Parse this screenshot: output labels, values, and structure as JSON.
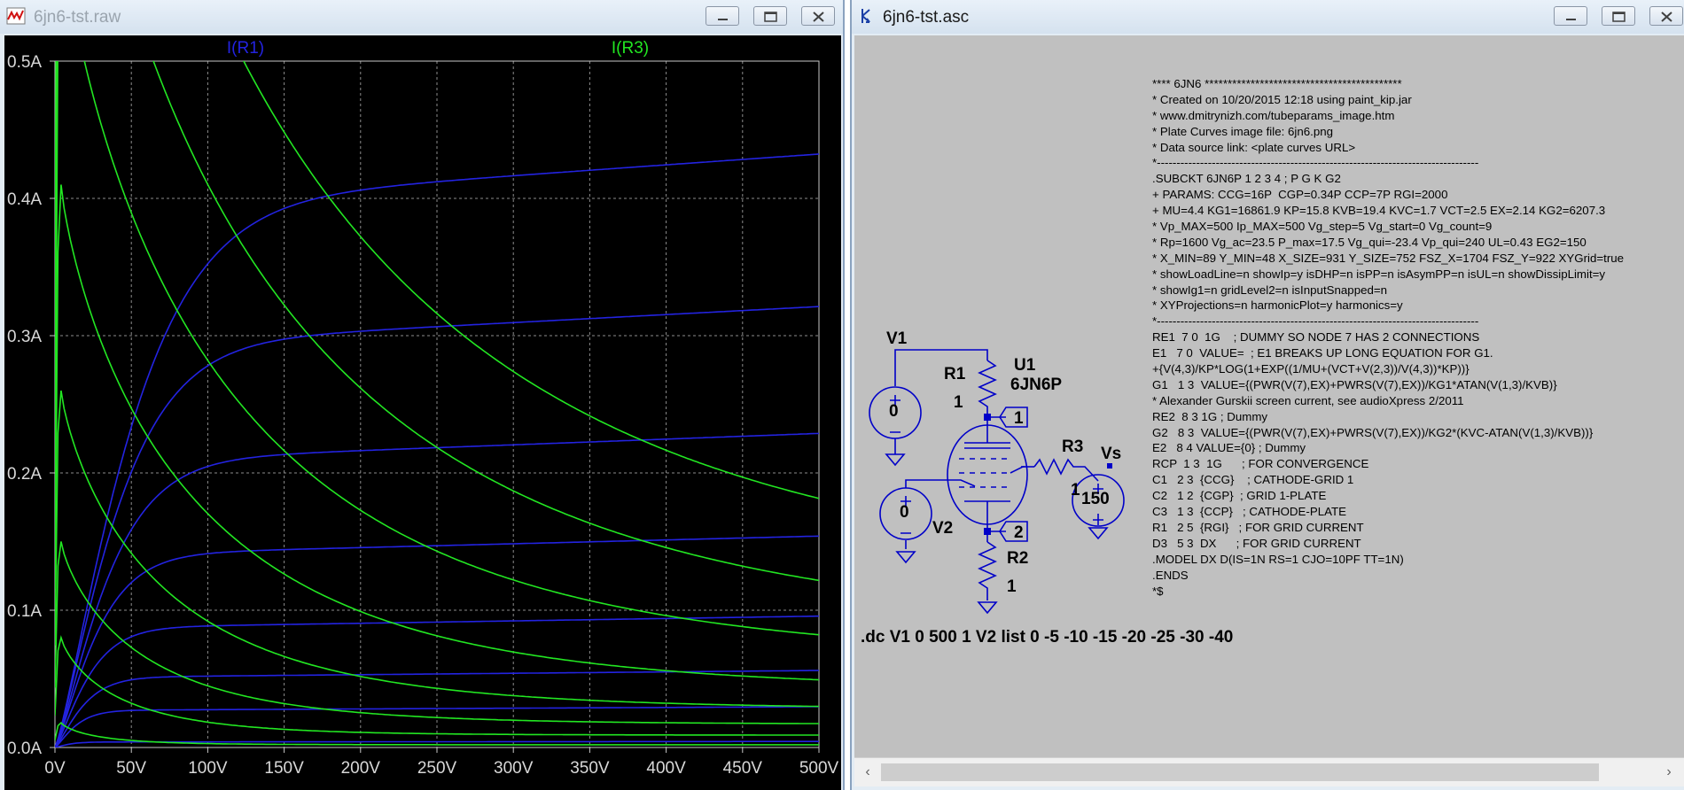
{
  "waveform_window": {
    "title": "6jn6-tst.raw",
    "icon": "waveform-viewer-icon"
  },
  "schematic_window": {
    "title": "6jn6-tst.asc",
    "icon": "schematic-editor-icon"
  },
  "window_controls": {
    "minimize": "minimize-icon",
    "maximize": "maximize-icon",
    "close": "close-icon"
  },
  "colors": {
    "ir1_trace": "#2323e0",
    "ir3_trace": "#22e622",
    "plot_bg": "#000000",
    "schematic_bg": "#c0c0c0",
    "wire": "#0000c8"
  },
  "chart_data": {
    "type": "line",
    "xlabel": "",
    "ylabel": "",
    "xlim": [
      0,
      500
    ],
    "ylim": [
      0,
      0.5
    ],
    "grid": true,
    "legend_placement": "top",
    "x_ticks": [
      "0V",
      "50V",
      "100V",
      "150V",
      "200V",
      "250V",
      "300V",
      "350V",
      "400V",
      "450V",
      "500V"
    ],
    "y_ticks": [
      "0.0A",
      "0.1A",
      "0.2A",
      "0.3A",
      "0.4A",
      "0.5A"
    ],
    "series_groups": [
      {
        "name": "I(R1)",
        "color": "#2323e0",
        "curves": [
          {
            "step": "V2=0",
            "plateau_A": 0.393,
            "knee_V": 55
          },
          {
            "step": "V2=-5",
            "plateau_A": 0.292,
            "knee_V": 45
          },
          {
            "step": "V2=-10",
            "plateau_A": 0.208,
            "knee_V": 38
          },
          {
            "step": "V2=-15",
            "plateau_A": 0.14,
            "knee_V": 30
          },
          {
            "step": "V2=-20",
            "plateau_A": 0.087,
            "knee_V": 24
          },
          {
            "step": "V2=-25",
            "plateau_A": 0.051,
            "knee_V": 20
          },
          {
            "step": "V2=-30",
            "plateau_A": 0.027,
            "knee_V": 15
          },
          {
            "step": "V2=-40",
            "plateau_A": 0.004,
            "knee_V": 10
          }
        ]
      },
      {
        "name": "I(R3)",
        "color": "#22e622",
        "curves": [
          {
            "step": "V2=0",
            "peak_A": 1.0,
            "end_A": 0.116,
            "decay_V": 150
          },
          {
            "step": "V2=-5",
            "peak_A": 0.8,
            "end_A": 0.083,
            "decay_V": 130
          },
          {
            "step": "V2=-10",
            "peak_A": 0.6,
            "end_A": 0.063,
            "decay_V": 110
          },
          {
            "step": "V2=-15",
            "peak_A": 0.41,
            "end_A": 0.042,
            "decay_V": 90
          },
          {
            "step": "V2=-20",
            "peak_A": 0.26,
            "end_A": 0.028,
            "decay_V": 70
          },
          {
            "step": "V2=-25",
            "peak_A": 0.15,
            "end_A": 0.017,
            "decay_V": 55
          },
          {
            "step": "V2=-30",
            "peak_A": 0.08,
            "end_A": 0.009,
            "decay_V": 40
          },
          {
            "step": "V2=-40",
            "peak_A": 0.018,
            "end_A": 0.002,
            "decay_V": 25
          }
        ]
      }
    ]
  },
  "schematic": {
    "v1_label": "V1",
    "v1_value": "0",
    "r1_label": "R1",
    "r1_value": "1",
    "u1_label": "U1",
    "u1_part": "6JN6P",
    "pin1": "1",
    "pin2": "2",
    "r3_label": "R3",
    "r3_value": "1",
    "vs_label": "Vs",
    "vs_value": "150",
    "v2_label": "V2",
    "v2_value": "0",
    "r2_label": "R2",
    "r2_value": "1",
    "dc_command": ".dc V1 0 500 1 V2 list 0 -5 -10 -15 -20 -25 -30 -40",
    "netlist_lines": [
      "**** 6JN6 *******************************************",
      "* Created on 10/20/2015 12:18 using paint_kip.jar",
      "* www.dmitrynizh.com/tubeparams_image.htm",
      "* Plate Curves image file: 6jn6.png",
      "* Data source link: <plate curves URL>",
      "*----------------------------------------------------------------------------------",
      ".SUBCKT 6JN6P 1 2 3 4 ; P G K G2",
      "+ PARAMS: CCG=16P  CGP=0.34P CCP=7P RGI=2000",
      "+ MU=4.4 KG1=16861.9 KP=15.8 KVB=19.4 KVC=1.7 VCT=2.5 EX=2.14 KG2=6207.3",
      "* Vp_MAX=500 Ip_MAX=500 Vg_step=5 Vg_start=0 Vg_count=9",
      "* Rp=1600 Vg_ac=23.5 P_max=17.5 Vg_qui=-23.4 Vp_qui=240 UL=0.43 EG2=150",
      "* X_MIN=89 Y_MIN=48 X_SIZE=931 Y_SIZE=752 FSZ_X=1704 FSZ_Y=922 XYGrid=true",
      "* showLoadLine=n showIp=y isDHP=n isPP=n isAsymPP=n isUL=n showDissipLimit=y",
      "* showIg1=n gridLevel2=n isInputSnapped=n",
      "* XYProjections=n harmonicPlot=y harmonics=y",
      "*----------------------------------------------------------------------------------",
      "RE1  7 0  1G    ; DUMMY SO NODE 7 HAS 2 CONNECTIONS",
      "E1   7 0  VALUE=  ; E1 BREAKS UP LONG EQUATION FOR G1.",
      "+{V(4,3)/KP*LOG(1+EXP((1/MU+(VCT+V(2,3))/V(4,3))*KP))}",
      "G1   1 3  VALUE={(PWR(V(7),EX)+PWRS(V(7),EX))/KG1*ATAN(V(1,3)/KVB)}",
      "* Alexander Gurskii screen current, see audioXpress 2/2011",
      "RE2  8 3 1G ; Dummy",
      "G2   8 3  VALUE={(PWR(V(7),EX)+PWRS(V(7),EX))/KG2*(KVC-ATAN(V(1,3)/KVB))}",
      "E2   8 4 VALUE={0} ; Dummy",
      "RCP  1 3  1G      ; FOR CONVERGENCE",
      "C1   2 3  {CCG}    ; CATHODE-GRID 1",
      "C2   1 2  {CGP}  ; GRID 1-PLATE",
      "C3   1 3  {CCP}   ; CATHODE-PLATE",
      "R1   2 5  {RGI}   ; FOR GRID CURRENT",
      "D3   5 3  DX      ; FOR GRID CURRENT",
      ".MODEL DX D(IS=1N RS=1 CJO=10PF TT=1N)",
      ".ENDS",
      "*$"
    ]
  },
  "scrollbar": {
    "left_arrow": "‹",
    "right_arrow": "›"
  }
}
